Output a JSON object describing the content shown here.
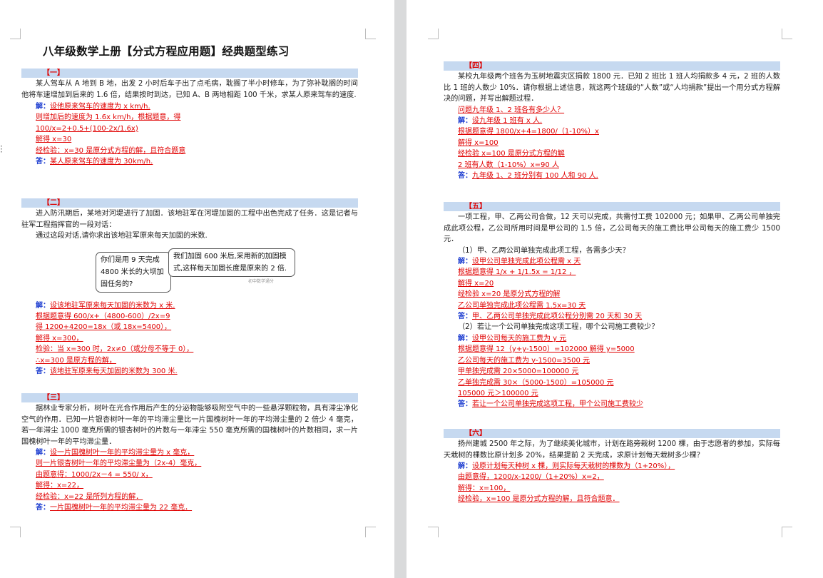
{
  "document_title": "八年级数学上册【分式方程应用题】经典题型练习",
  "sections": [
    {
      "header": "【一】",
      "text": "某人驾车从 A 地到 B 地，出发 2 小时后车子出了点毛病，耽搁了半小时修车，为了弥补耽搁的时间他将车速增加到后来的 1.6 倍，结果按时到达，已知 A、B 两地相距 100 千米，求某人原来驾车的速度.",
      "solution": [
        {
          "label": "解：",
          "text": "设他原来驾车的速度为 x km/h."
        },
        {
          "text": "则增加后的速度为 1.6x km/h，根据题意，得"
        },
        {
          "text": "100/x=2+0.5+(100-2x/1.6x)"
        },
        {
          "text": "解得 x=30"
        },
        {
          "text": "经检验：x=30 是原分式方程的解，且符合题意"
        },
        {
          "label": "答：",
          "text": "某人原来驾车的速度为 30km/h."
        }
      ]
    },
    {
      "header": "【二】",
      "text": "进入防汛期后，某地对河堤进行了加固．该地驻军在河堤加固的工程中出色完成了任务．这是记者与驻军工程指挥官的一段对话：",
      "text2": "通过这段对话,请你求出该地驻军原来每天加固的米数.",
      "bubble1": "你们是用 9 天完成 4800 米长的大坝加固任务的?",
      "bubble2": "我们加固 600 米后,采用新的加固模式,这样每天加固长度是原来的 2 倍.",
      "watermark": "初中数学通分",
      "solution": [
        {
          "label": "解：",
          "text": "设该地驻军原来每天加固的米数为 x 米."
        },
        {
          "text": "根据题意得 600/x+（4800-600）/2x=9"
        },
        {
          "text": "得 1200+4200=18x（或 18x=5400），"
        },
        {
          "text": "解得 x=300，"
        },
        {
          "text": "检验：当 x=300 时，2x≠0（或分母不等于 0），"
        },
        {
          "text": "∴x=300 是原方程的解，"
        },
        {
          "label": "答：",
          "text": "该地驻军原来每天加固的米数为 300 米."
        }
      ]
    },
    {
      "header": "【三】",
      "text": "据林业专家分析，树叶在光合作用后产生的分泌物能够吸附空气中的一些悬浮颗粒物，具有滞尘净化空气的作用．已知一片银杏树叶一年的平均滞尘量比一片国槐树叶一年的平均滞尘量的 2 倍少 4 毫克，若一年滞尘 1000 毫克所需的银杏树叶的片数与一年滞尘 550 毫克所需的国槐树叶的片数相同，求一片国槐树叶一年的平均滞尘量．",
      "solution": [
        {
          "label": "解：",
          "text": "设一片国槐树叶一年的平均滞尘量为 x 毫克，"
        },
        {
          "text": "则一片银杏树叶一年的平均滞尘量为（2x-4）毫克，"
        },
        {
          "text": "由题意得：1000/2x－4 = 550/ x，"
        },
        {
          "text": "解得：x=22，"
        },
        {
          "text": "经检验：x=22 是所列方程的解．"
        },
        {
          "label": "答：",
          "text": "一片国槐树叶一年的平均滞尘量为 22 毫克．"
        }
      ]
    },
    {
      "header": "【四】",
      "text": "某校九年级两个班各为玉树地震灾区捐款 1800 元．已知 2 班比 1 班人均捐款多 4 元，2 班的人数比 1 班的人数少 10%．请你根据上述信息，就这两个班级的“人数”或“人均捐款”提出一个用分式方程解决的问题，并写出解题过程．",
      "solution": [
        {
          "text": "问题九年级 1、2 班各有多少人？"
        },
        {
          "label": "解：",
          "text": "设九年级 1 班有 x 人."
        },
        {
          "text": "根据题意得 1800/x+4=1800/（1-10%）x"
        },
        {
          "text": "解得 x=100"
        },
        {
          "text": "经检验 x=100 是原分式方程的解"
        },
        {
          "text": "2 班有人数（1-10%）x=90 人"
        },
        {
          "label": "答：",
          "text": "九年级 1、2 班分别有 100 人和 90 人."
        }
      ]
    },
    {
      "header": "【五】",
      "text": "一项工程，甲、乙两公司合做，12 天可以完成，共需付工费 102000 元；如果甲、乙两公司单独完成此项公程，乙公司所用时间是甲公司的 1.5 倍，乙公司每天的施工费比甲公司每天的施工费少 1500 元．",
      "q1": "（1）甲、乙两公司单独完成此项工程，各需多少天？",
      "solution1": [
        {
          "label": "解：",
          "text": "设甲公司单独完成此项公程需 x 天"
        },
        {
          "text": "根据题意得 1/x + 1/1.5x = 1/12 ，"
        },
        {
          "text": "解得 x=20"
        },
        {
          "text": "经检验 x=20 是原分式方程的解"
        },
        {
          "text": "乙公司单独完成此项公程需 1.5x=30 天"
        },
        {
          "label": "答：",
          "text": "甲、乙两公司单独完成此项公程分别需 20 天和 30 天"
        }
      ],
      "q2": "（2）若让一个公司单独完成这项工程，哪个公司施工费较少？",
      "solution2": [
        {
          "label": "解：",
          "text": "设甲公司每天的施工费为 y 元"
        },
        {
          "text": "根据题意得 12（y+y-1500）=102000  解得 y=5000"
        },
        {
          "text": "乙公司每天的施工费为 y-1500=3500 元"
        },
        {
          "text": "甲单独完成需 20×5000=100000 元"
        },
        {
          "text": "乙单独完成需 30×（5000-1500）=105000 元"
        },
        {
          "text": "105000 元＞100000 元"
        },
        {
          "label": "答：",
          "text": "若让一个公司单独完成这项工程，甲个公司施工费较少"
        }
      ]
    },
    {
      "header": "【六】",
      "text": "扬州建城 2500 年之际，为了继续美化城市，计划在路旁栽树 1200 棵，由于志愿者的参加，实际每天栽树的棵数比原计划多 20%，结果提前 2 天完成，求原计划每天栽树多少棵？",
      "solution": [
        {
          "label": "解：",
          "text": "设原计划每天种树 x 棵，则实际每天栽树的棵数为（1+20%），"
        },
        {
          "text": "由题意得，1200/x-1200/（1+20%）x=2，"
        },
        {
          "text": "解得：x=100，"
        },
        {
          "text": "经检验，x=100 是原分式方程的解，且符合题意．"
        }
      ]
    }
  ]
}
